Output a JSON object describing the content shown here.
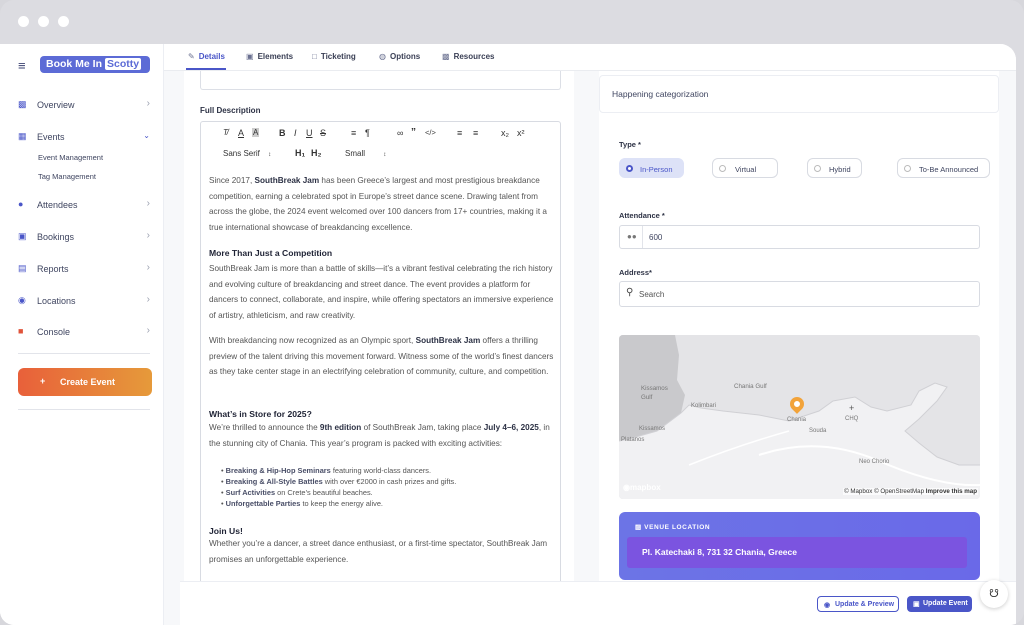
{
  "brand": {
    "name": "Book Me In",
    "highlight": "Scotty"
  },
  "sidebar": {
    "items": [
      {
        "label": "Overview",
        "icon": "bar-chart-icon"
      },
      {
        "label": "Events",
        "icon": "calendar-icon"
      },
      {
        "label": "Attendees",
        "icon": "users-icon"
      },
      {
        "label": "Bookings",
        "icon": "ticket-icon"
      },
      {
        "label": "Reports",
        "icon": "reports-icon"
      },
      {
        "label": "Locations",
        "icon": "pin-icon"
      },
      {
        "label": "Console",
        "icon": "briefcase-icon"
      }
    ],
    "sub_items": [
      "Event Management",
      "Tag Management"
    ],
    "create_event": "Create Event"
  },
  "tabs": [
    "Details",
    "Elements",
    "Ticketing",
    "Options",
    "Resources"
  ],
  "editor": {
    "label": "Full Description",
    "font": "Sans Serif",
    "heading1": "H₁",
    "heading2": "H₂",
    "size": "Small",
    "p1": [
      "Since 2017, ",
      "SouthBreak Jam",
      " has been Greece’s largest and most prestigious breakdance competition, earning a celebrated spot in Europe’s street dance scene. Drawing talent from across the globe, the 2024 event welcomed over 100 dancers from 17+ countries, making it a true international showcase of breakdancing excellence."
    ],
    "h2": "More Than Just a Competition",
    "p2": "SouthBreak Jam is more than a battle of skills—it’s a vibrant festival celebrating the rich history and evolving culture of breakdancing and street dance. The event provides a platform for dancers to connect, collaborate, and inspire, while offering spectators an immersive experience of artistry, athleticism, and raw creativity.",
    "p3": [
      "With breakdancing now recognized as an Olympic sport, ",
      "SouthBreak Jam",
      " offers a thrilling preview of the talent driving this movement forward. Witness some of the world’s finest dancers as they take center stage in an electrifying celebration of community, culture, and competition."
    ],
    "h3": "What’s in Store for 2025?",
    "p4": [
      "We’re thrilled to announce the ",
      "9th edition",
      " of SouthBreak Jam, taking place ",
      "July 4–6, 2025",
      ", in the stunning city of Chania. This year’s program is packed with exciting activities:"
    ],
    "bullets": [
      {
        "b": "Breaking & Hip-Hop Seminars",
        "t": " featuring world-class dancers."
      },
      {
        "b": "Breaking & All-Style Battles",
        "t": " with over €2000 in cash prizes and gifts."
      },
      {
        "b": "Surf Activities",
        "t": " on Crete’s beautiful beaches."
      },
      {
        "b": "Unforgettable Parties",
        "t": " to keep the energy alive."
      }
    ],
    "h4": "Join Us!",
    "p5": "Whether you’re a dancer, a street dance enthusiast, or a first-time spectator, SouthBreak Jam promises an unforgettable experience."
  },
  "right": {
    "header": "Happening categorization",
    "type_label": "Type *",
    "types": [
      "In-Person",
      "Virtual",
      "Hybrid",
      "To-Be Announced"
    ],
    "selected_type": "In-Person",
    "attendance_label": "Attendance *",
    "attendance_value": "600",
    "address_label": "Address*",
    "search_placeholder": "Search",
    "map_labels": {
      "kissamos_gulf": "Kissamos Gulf",
      "chania_gulf": "Chania Gulf",
      "kolimbari": "Kolimbari",
      "kissamos": "Kissamos",
      "chania": "Chania",
      "souda": "Souda",
      "chq": "CHQ",
      "platanos": "Platanos",
      "neo_chorio": "Neo Chorio"
    },
    "map_attribution": [
      "© Mapbox © OpenStreetMap ",
      "Improve this map"
    ],
    "map_logo": "mapbox",
    "venue_label": "VENUE LOCATION",
    "venue_address": "Pl. Katechaki 8, 731 32 Chania, Greece"
  },
  "footer": {
    "preview": "Update & Preview",
    "update": "Update Event"
  }
}
